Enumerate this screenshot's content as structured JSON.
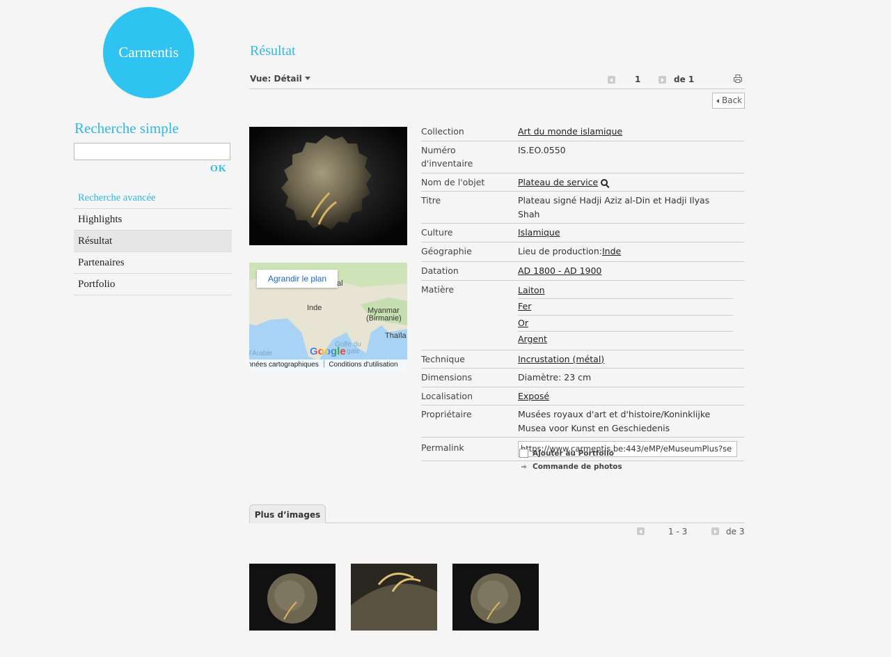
{
  "logo": {
    "text": "Carmentis"
  },
  "sidebar": {
    "search_title": "Recherche simple",
    "search_value": "",
    "ok_label": "OK",
    "nav": [
      {
        "label": "Recherche avancée"
      },
      {
        "label": "Highlights"
      },
      {
        "label": "Résultat"
      },
      {
        "label": "Partenaires"
      },
      {
        "label": "Portfolio"
      }
    ]
  },
  "main": {
    "title": "Résultat",
    "view_label": "Vue: Détail",
    "pager": {
      "current": "1",
      "total": "de 1"
    },
    "back_label": "Back",
    "map": {
      "enlarge_label": "Agrandir le plan",
      "labels": [
        "Inde",
        "Myanmar",
        "(Birmanie)",
        "Thaïla",
        "Golfe du",
        "gale",
        "l'Arabie",
        "al"
      ],
      "footer_data": "nnées cartographiques",
      "footer_terms": "Conditions d'utilisation",
      "google": "Google"
    },
    "details": {
      "collection": {
        "label": "Collection",
        "value": "Art du monde islamique"
      },
      "inventory": {
        "label": "Numéro d'inventaire",
        "value": "IS.EO.0550"
      },
      "object_name": {
        "label": "Nom de l'objet",
        "value": "Plateau de service"
      },
      "title": {
        "label": "Titre",
        "value": "Plateau signé Hadji Aziz al-Din et Hadji Ilyas Shah"
      },
      "culture": {
        "label": "Culture",
        "value": "Islamique"
      },
      "geography": {
        "label": "Géographie",
        "prefix": "Lieu de production:",
        "value": "Inde"
      },
      "dating": {
        "label": "Datation",
        "value": "AD 1800 - AD 1900"
      },
      "material": {
        "label": "Matière",
        "values": [
          "Laiton",
          "Fer",
          "Or",
          "Argent"
        ]
      },
      "technique": {
        "label": "Technique",
        "value": "Incrustation (métal)"
      },
      "dimensions": {
        "label": "Dimensions",
        "value": "Diamètre: 23 cm"
      },
      "location": {
        "label": "Localisation",
        "value": "Exposé"
      },
      "owner": {
        "label": "Propriétaire",
        "value": "Musées royaux d'art et d'histoire/Koninklijke Musea voor Kunst en Geschiedenis"
      },
      "permalink": {
        "label": "Permalink",
        "value": "https://www.carmentis.be:443/eMP/eMuseumPlus?se"
      }
    },
    "add_portfolio_label": "Ajouter au Portfolio",
    "photo_order_label": "Commande de photos",
    "more_images_tab": "Plus d’images",
    "images_pager": {
      "range": "1 - 3",
      "total": "de 3"
    }
  },
  "colors": {
    "accent": "#2fc3f2",
    "background": "#f5f5f5"
  }
}
